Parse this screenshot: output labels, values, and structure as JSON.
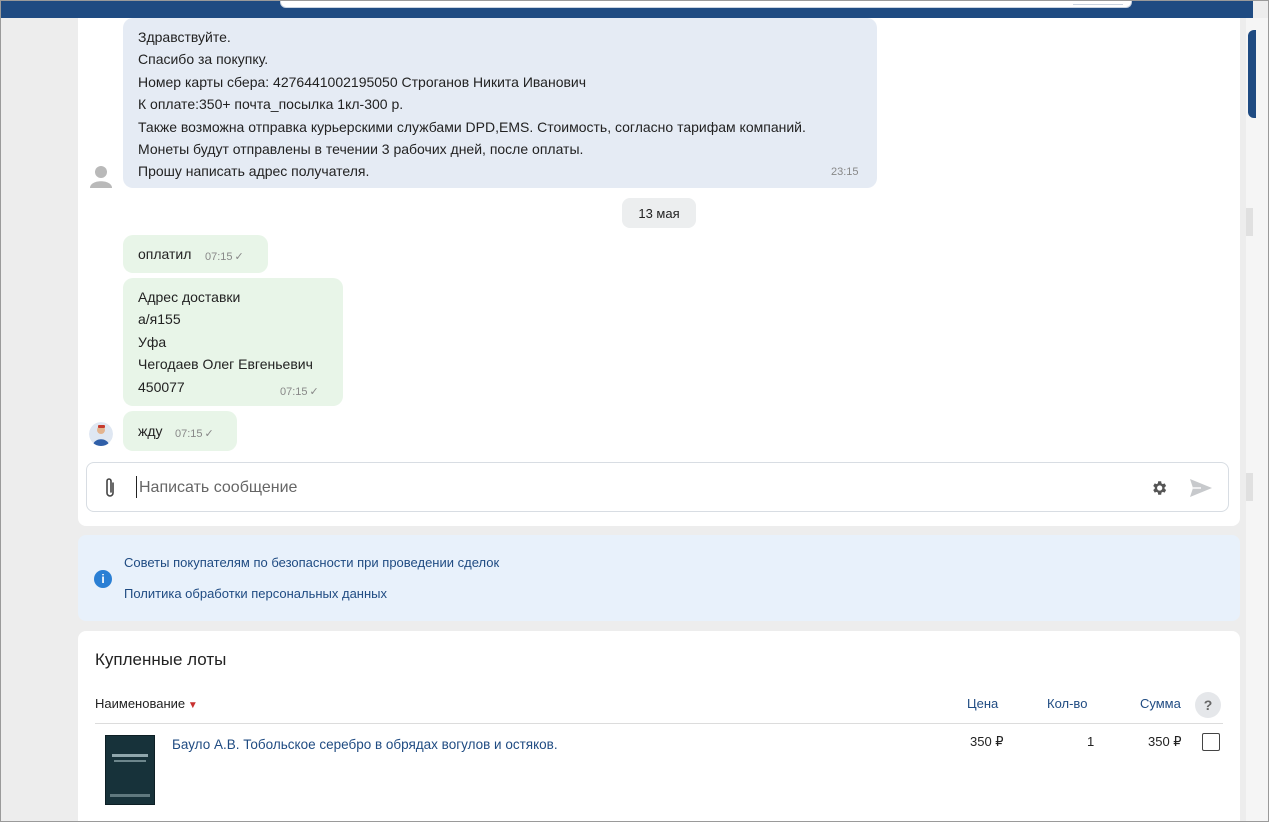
{
  "chat": {
    "incoming_message": {
      "lines": "Здравствуйте.\nСпасибо за покупку.\nНомер карты сбера: 4276441002195050 Строганов Никита Иванович\nК оплате:350+ почта_посылка 1кл-300 р.\nТакже возможна отправка курьерскими службами DPD,EMS. Стоимость, согласно тарифам компаний.\nМонеты будут отправлены в течении 3 рабочих дней, после оплаты.\nПрошу написать адрес получателя.",
      "time": "23:15"
    },
    "date_separator": "13 мая",
    "outgoing_messages": [
      {
        "text": "оплатил",
        "time": "07:15",
        "check": "✓"
      },
      {
        "text": "Адрес доставки\nа/я155\nУфа\nЧегодаев Олег Евгеньевич\n450077",
        "time": "07:15",
        "check": "✓"
      },
      {
        "text": "жду",
        "time": "07:15",
        "check": "✓"
      }
    ],
    "composer": {
      "placeholder": "Написать сообщение",
      "value": ""
    }
  },
  "tips": {
    "link_safety": "Советы покупателям по безопасности при проведении сделок",
    "link_privacy": "Политика обработки персональных данных"
  },
  "lots": {
    "title": "Купленные лоты",
    "columns": {
      "name": "Наименование",
      "price": "Цена",
      "qty": "Кол-во",
      "sum": "Сумма",
      "help": "?"
    },
    "rows": [
      {
        "name": "Бауло А.В. Тобольское серебро в обрядах вогулов и остяков.",
        "price": "350 ₽",
        "qty": "1",
        "sum": "350 ₽"
      }
    ]
  },
  "colors": {
    "header_blue": "#1f4b82",
    "incoming_bubble": "#e5ebf4",
    "outgoing_bubble": "#e8f5e8",
    "link": "#1f4b82",
    "sort_arrow": "#c8312f",
    "info_icon": "#2a7fd4"
  }
}
